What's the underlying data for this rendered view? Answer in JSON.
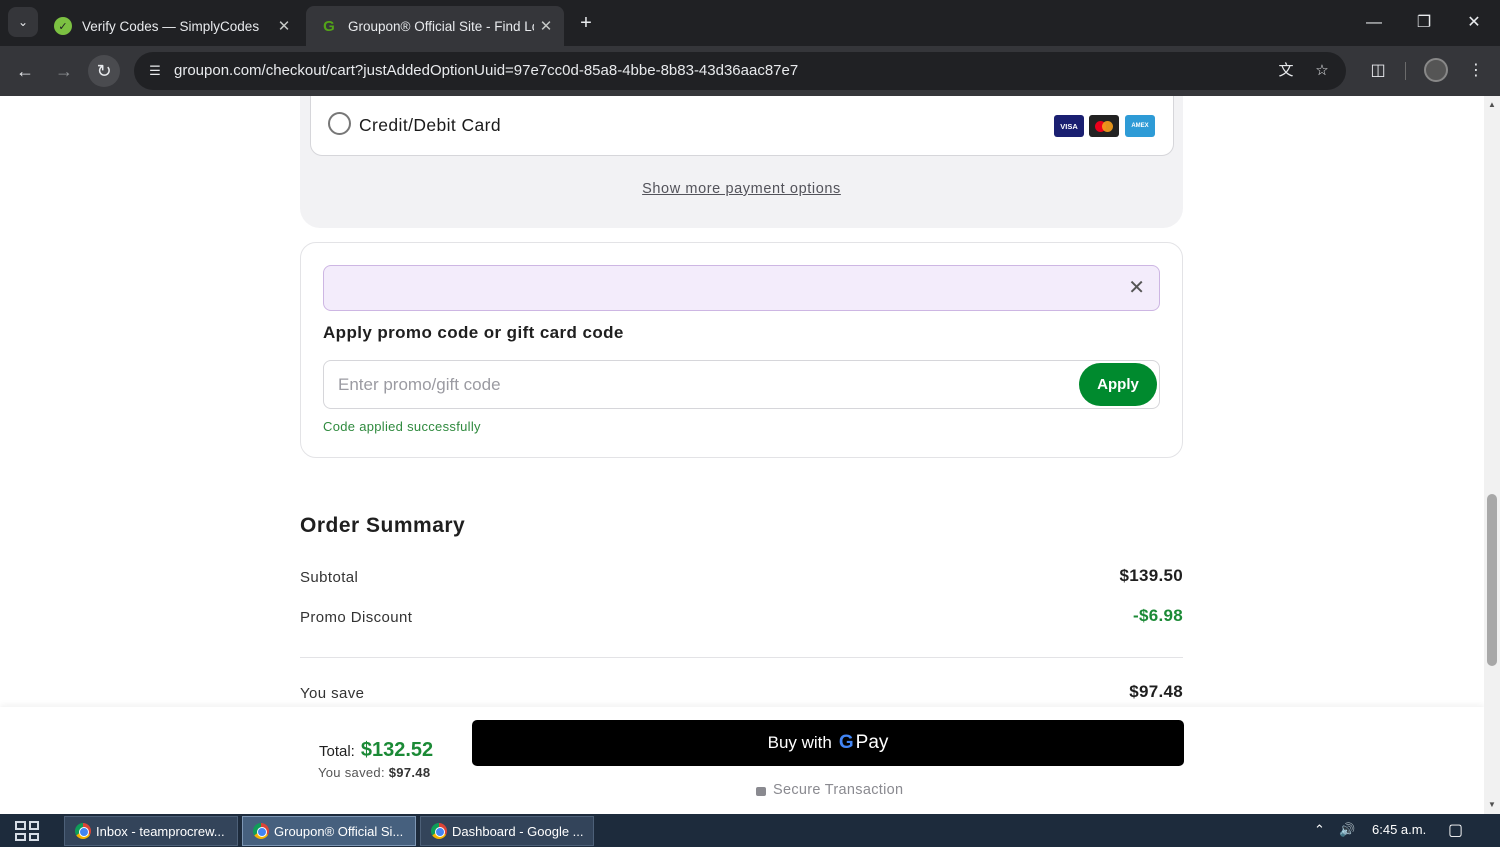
{
  "browser": {
    "tabs": [
      {
        "title": "Verify Codes — SimplyCodes",
        "active": false
      },
      {
        "title": "Groupon® Official Site - Find Lo",
        "active": true
      }
    ],
    "url": "groupon.com/checkout/cart?justAddedOptionUuid=97e7cc0d-85a8-4bbe-8b83-43d36aac87e7"
  },
  "payment": {
    "card_option_label": "Credit/Debit Card",
    "card_brands": [
      "VISA",
      "",
      "AMEX"
    ],
    "show_more_label": "Show more payment options"
  },
  "promo": {
    "title": "Apply promo code or gift card code",
    "placeholder": "Enter promo/gift code",
    "apply_label": "Apply",
    "success_message": "Code applied successfully"
  },
  "summary": {
    "title": "Order Summary",
    "rows": [
      {
        "label": "Subtotal",
        "value": "$139.50"
      },
      {
        "label": "Promo Discount",
        "value": "-$6.98"
      },
      {
        "label": "You save",
        "value": "$97.48"
      }
    ]
  },
  "checkout_bar": {
    "total_label": "Total:",
    "total_value": "$132.52",
    "saved_label": "You saved:",
    "saved_value": "$97.48",
    "buy_label": "Buy with",
    "gpay_g": "G",
    "gpay_pay": "Pay",
    "secure_label": "Secure Transaction"
  },
  "taskbar": {
    "items": [
      {
        "label": "Inbox - teamprocrew..."
      },
      {
        "label": "Groupon® Official Si..."
      },
      {
        "label": "Dashboard - Google ..."
      }
    ],
    "time": "6:45 a.m."
  },
  "colors": {
    "accent_green": "#008a2e",
    "discount_green": "#1b8a36",
    "promo_banner_bg": "#f3ecfb"
  }
}
